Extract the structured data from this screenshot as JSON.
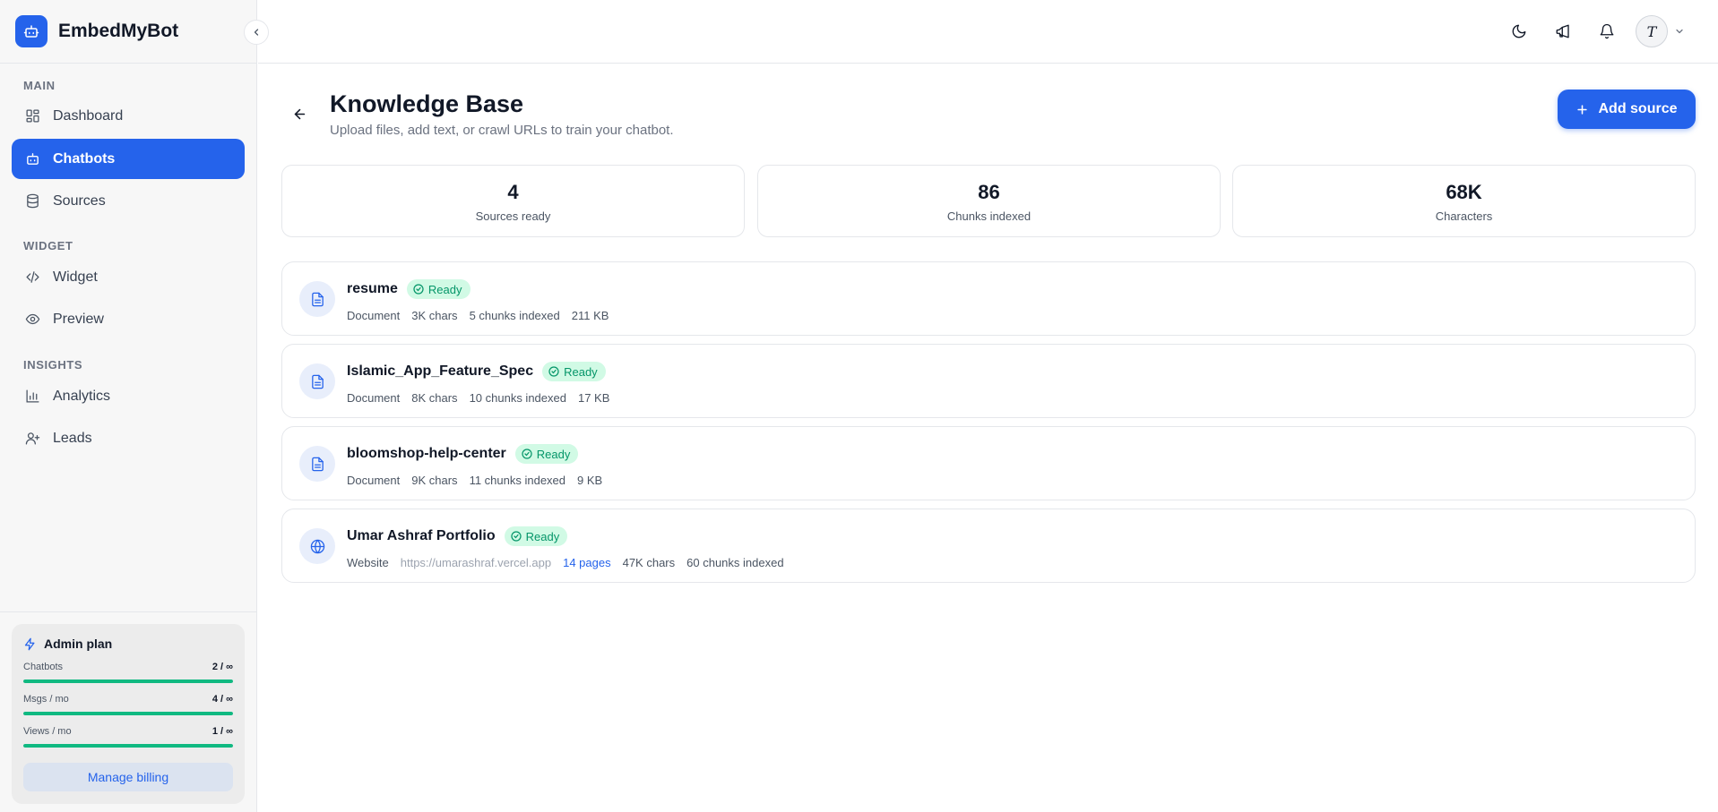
{
  "brand": {
    "name": "EmbedMyBot"
  },
  "nav": {
    "sections": [
      {
        "label": "MAIN"
      },
      {
        "label": "WIDGET"
      },
      {
        "label": "INSIGHTS"
      }
    ],
    "items": [
      {
        "label": "Dashboard",
        "icon": "grid-icon"
      },
      {
        "label": "Chatbots",
        "icon": "bot-icon",
        "active": true
      },
      {
        "label": "Sources",
        "icon": "database-icon"
      },
      {
        "label": "Widget",
        "icon": "code-icon"
      },
      {
        "label": "Preview",
        "icon": "eye-icon"
      },
      {
        "label": "Analytics",
        "icon": "bar-chart-icon"
      },
      {
        "label": "Leads",
        "icon": "user-plus-icon"
      }
    ]
  },
  "plan": {
    "title": "Admin plan",
    "usage": [
      {
        "label": "Chatbots",
        "value": "2 / ∞",
        "fill": 1.0
      },
      {
        "label": "Msgs / mo",
        "value": "4 / ∞",
        "fill": 1.0
      },
      {
        "label": "Views / mo",
        "value": "1 / ∞",
        "fill": 1.0
      }
    ],
    "billing_label": "Manage billing"
  },
  "topbar": {
    "icons": [
      "moon-icon",
      "megaphone-icon",
      "bell-icon"
    ],
    "avatar_initial": "T"
  },
  "page": {
    "title": "Knowledge Base",
    "subtitle": "Upload files, add text, or crawl URLs to train your chatbot.",
    "add_label": "Add source"
  },
  "stats": [
    {
      "value": "4",
      "label": "Sources ready"
    },
    {
      "value": "86",
      "label": "Chunks indexed"
    },
    {
      "value": "68K",
      "label": "Characters"
    }
  ],
  "sources": [
    {
      "name": "resume",
      "status": "Ready",
      "type": "Document",
      "chars": "3K chars",
      "chunks": "5 chunks indexed",
      "size": "211 KB"
    },
    {
      "name": "Islamic_App_Feature_Spec",
      "status": "Ready",
      "type": "Document",
      "chars": "8K chars",
      "chunks": "10 chunks indexed",
      "size": "17 KB"
    },
    {
      "name": "bloomshop-help-center",
      "status": "Ready",
      "type": "Document",
      "chars": "9K chars",
      "chunks": "11 chunks indexed",
      "size": "9 KB"
    },
    {
      "name": "Umar Ashraf Portfolio",
      "status": "Ready",
      "type": "Website",
      "url": "https://umarashraf.vercel.app",
      "pages": "14 pages",
      "chars": "47K chars",
      "chunks": "60 chunks indexed"
    }
  ],
  "colors": {
    "accent": "#2563eb",
    "success": "#10b981",
    "badge_bg": "#d1fae5"
  }
}
